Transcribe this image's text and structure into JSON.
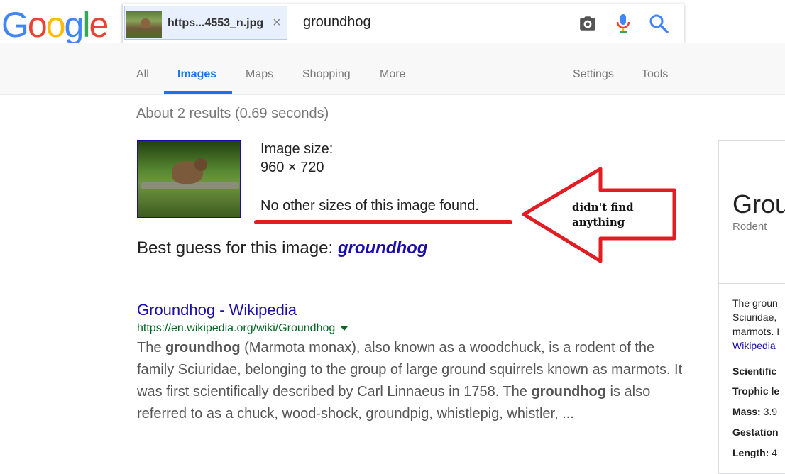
{
  "logo": {
    "text": "Google"
  },
  "search": {
    "image_chip_label": "https...4553_n.jpg",
    "chip_close": "×",
    "query": "groundhog"
  },
  "tabs": {
    "all": "All",
    "images": "Images",
    "maps": "Maps",
    "shopping": "Shopping",
    "more": "More",
    "settings": "Settings",
    "tools": "Tools"
  },
  "result_stats": "About 2 results (0.69 seconds)",
  "image_info": {
    "size_label": "Image size:",
    "size_value": "960 × 720",
    "no_sizes": "No other sizes of this image found."
  },
  "annotation": {
    "line1": "didn't find",
    "line2": "anything",
    "color": "#e31c23"
  },
  "best_guess": {
    "label": "Best guess for this image:",
    "value": "groundhog"
  },
  "result": {
    "title": "Groundhog - Wikipedia",
    "url": "https://en.wikipedia.org/wiki/Groundhog",
    "snippet": {
      "w1": "groundhog",
      "p1": " (Marmota monax), also known as a woodchuck, is a rodent of the family Sciuridae, belonging to the group of large ground squirrels known as marmots. It was first scientifically described by Carl Linnaeus in 1758. The ",
      "w2": "groundhog",
      "p2": " is also referred to as a chuck, wood-shock, groundpig, whistlepig, whistler, ...",
      "lead": "The "
    }
  },
  "knowledge_panel": {
    "title": "Grou",
    "subtitle": "Rodent",
    "desc_line1": "The groun",
    "desc_line2": "Sciuridae,",
    "desc_line3": "marmots. I",
    "desc_link": "Wikipedia",
    "facts": [
      {
        "label": "Scientific",
        "value": ""
      },
      {
        "label": "Trophic le",
        "value": ""
      },
      {
        "label": "Mass:",
        "value": " 3.9"
      },
      {
        "label": "Gestation",
        "value": ""
      },
      {
        "label": "Length:",
        "value": " 4"
      }
    ]
  }
}
